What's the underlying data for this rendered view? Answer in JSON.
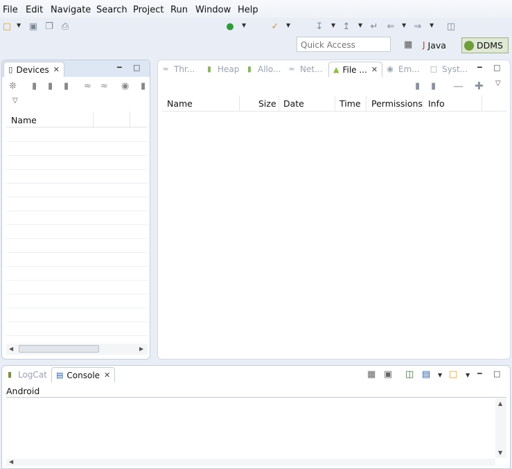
{
  "menu": {
    "items": [
      "File",
      "Edit",
      "Navigate",
      "Search",
      "Project",
      "Run",
      "Window",
      "Help"
    ]
  },
  "toolbar": {
    "icons": [
      "new-icon",
      "save-icon",
      "save-all-icon",
      "print-icon",
      "run-icon",
      "debug-icon",
      "next-annotation-icon",
      "prev-annotation-icon",
      "last-edit-icon",
      "back-icon",
      "forward-icon",
      "pin-icon"
    ]
  },
  "quick_access": {
    "placeholder": "Quick Access"
  },
  "perspectives": {
    "java": "Java",
    "ddms": "DDMS"
  },
  "devices_panel": {
    "tab_label": "Devices",
    "column_name": "Name"
  },
  "right_panel": {
    "tabs": [
      "Thr...",
      "Heap",
      "Allo...",
      "Net...",
      "File ...",
      "Em...",
      "Syst..."
    ],
    "active_tab": "File ...",
    "columns": [
      "Name",
      "Size",
      "Date",
      "Time",
      "Permissions",
      "Info"
    ]
  },
  "bottom_panel": {
    "tabs": [
      "LogCat",
      "Console"
    ],
    "active_tab": "Console",
    "console_title": "Android"
  }
}
